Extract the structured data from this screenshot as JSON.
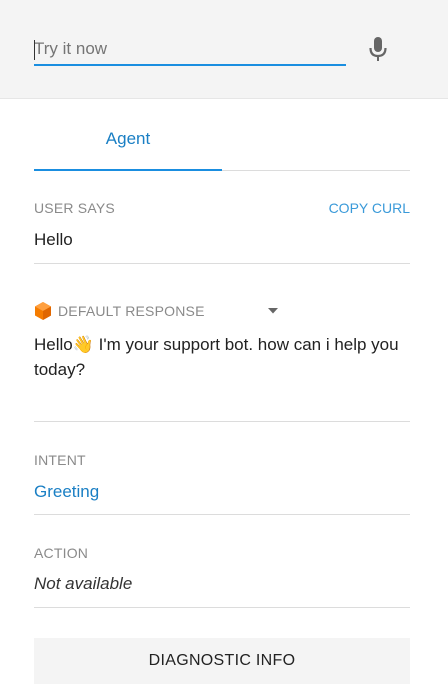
{
  "search": {
    "placeholder": "Try it now",
    "value": ""
  },
  "tabs": [
    {
      "label": "Agent",
      "active": true
    }
  ],
  "user_says": {
    "label": "USER SAYS",
    "value": "Hello",
    "copy_label": "COPY CURL"
  },
  "response": {
    "label": "DEFAULT RESPONSE",
    "text": "Hello👋 I'm your support bot. how can i help you today?"
  },
  "intent": {
    "label": "INTENT",
    "value": "Greeting"
  },
  "action": {
    "label": "ACTION",
    "value": "Not available"
  },
  "diagnostic": {
    "label": "DIAGNOSTIC INFO"
  },
  "colors": {
    "accent": "#1a8ee0",
    "link": "#1a7fc4",
    "brand_icon": "#f57c00",
    "muted": "#8a8a8a"
  },
  "icons": {
    "mic": "microphone-icon",
    "agent_logo": "dialogflow-icon",
    "dropdown": "caret-down-icon"
  }
}
